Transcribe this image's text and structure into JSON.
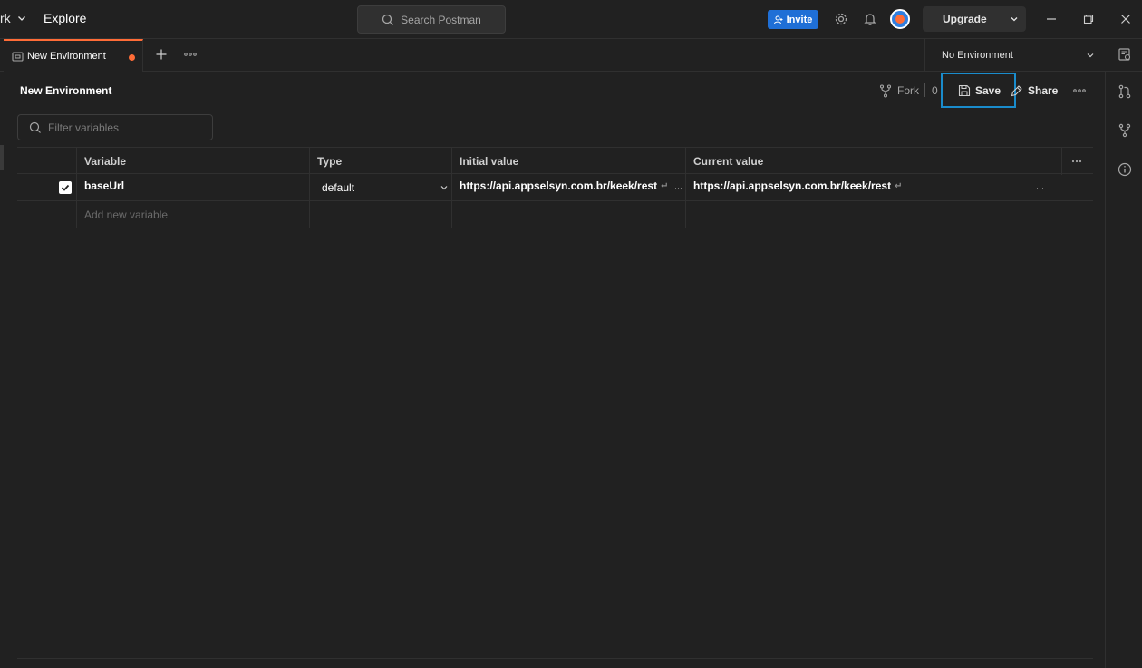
{
  "topbar": {
    "workspace_label": "rk",
    "explore_label": "Explore",
    "search_placeholder": "Search Postman",
    "invite_label": "Invite",
    "upgrade_label": "Upgrade"
  },
  "tabs": {
    "active_tab_label": "New Environment",
    "environment_selector": "No Environment"
  },
  "environment": {
    "title": "New Environment",
    "fork_label": "Fork",
    "fork_count": "0",
    "save_label": "Save",
    "share_label": "Share",
    "filter_placeholder": "Filter variables"
  },
  "table": {
    "headers": {
      "variable": "Variable",
      "type": "Type",
      "initial_value": "Initial value",
      "current_value": "Current value"
    },
    "rows": [
      {
        "enabled": true,
        "variable": "baseUrl",
        "type": "default",
        "initial_value": "https://api.appselsyn.com.br/keek/rest",
        "current_value": "https://api.appselsyn.com.br/keek/rest"
      }
    ],
    "new_variable_placeholder": "Add new variable"
  },
  "colors": {
    "background": "#212121",
    "accent_orange": "#ff6c37",
    "invite_blue": "#1f6fd6",
    "highlight_border": "#1a8ccc"
  },
  "icons": [
    "search-icon",
    "invite-user-icon",
    "settings-icon",
    "bell-icon",
    "avatar",
    "chevron-down-icon",
    "minimize-icon",
    "restore-icon",
    "close-icon",
    "environment-icon",
    "plus-icon",
    "more-icon",
    "fork-icon",
    "save-icon",
    "share-icon",
    "pull-request-icon",
    "git-fork-icon",
    "info-icon",
    "environment-quicklook-icon",
    "check-icon"
  ]
}
